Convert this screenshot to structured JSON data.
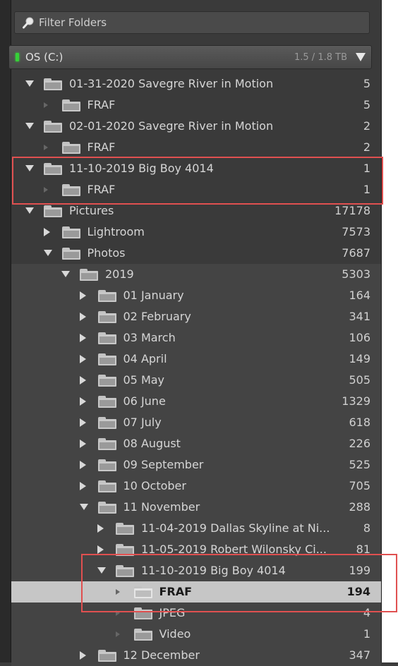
{
  "filter": {
    "label": "Filter Folders"
  },
  "volume": {
    "name": "OS (C:)",
    "size": "1.5 / 1.8 TB"
  },
  "tree": [
    {
      "name": "01-31-2020 Savegre River in Motion",
      "count": "5",
      "level": 0,
      "toggle": "open"
    },
    {
      "name": "FRAF",
      "count": "5",
      "level": 1,
      "toggle": "leaf"
    },
    {
      "name": "02-01-2020 Savegre River in Motion",
      "count": "2",
      "level": 0,
      "toggle": "open"
    },
    {
      "name": "FRAF",
      "count": "2",
      "level": 1,
      "toggle": "leaf"
    },
    {
      "name": "11-10-2019 Big Boy 4014",
      "count": "1",
      "level": 0,
      "toggle": "open"
    },
    {
      "name": "FRAF",
      "count": "1",
      "level": 1,
      "toggle": "leaf"
    },
    {
      "name": "Pictures",
      "count": "17178",
      "level": 0,
      "toggle": "open"
    },
    {
      "name": "Lightroom",
      "count": "7573",
      "level": 1,
      "toggle": "closed"
    },
    {
      "name": "Photos",
      "count": "7687",
      "level": 1,
      "toggle": "open"
    },
    {
      "name": "2019",
      "count": "5303",
      "level": 2,
      "toggle": "open"
    },
    {
      "name": "01 January",
      "count": "164",
      "level": 3,
      "toggle": "closed"
    },
    {
      "name": "02 February",
      "count": "341",
      "level": 3,
      "toggle": "closed"
    },
    {
      "name": "03 March",
      "count": "106",
      "level": 3,
      "toggle": "closed"
    },
    {
      "name": "04 April",
      "count": "149",
      "level": 3,
      "toggle": "closed"
    },
    {
      "name": "05 May",
      "count": "505",
      "level": 3,
      "toggle": "closed"
    },
    {
      "name": "06 June",
      "count": "1329",
      "level": 3,
      "toggle": "closed"
    },
    {
      "name": "07 July",
      "count": "618",
      "level": 3,
      "toggle": "closed"
    },
    {
      "name": "08 August",
      "count": "226",
      "level": 3,
      "toggle": "closed"
    },
    {
      "name": "09 September",
      "count": "525",
      "level": 3,
      "toggle": "closed"
    },
    {
      "name": "10 October",
      "count": "705",
      "level": 3,
      "toggle": "closed"
    },
    {
      "name": "11 November",
      "count": "288",
      "level": 3,
      "toggle": "open"
    },
    {
      "name": "11-04-2019 Dallas Skyline at Ni...",
      "count": "8",
      "level": 4,
      "toggle": "closed"
    },
    {
      "name": "11-05-2019 Robert Wilonsky Ci...",
      "count": "81",
      "level": 4,
      "toggle": "closed"
    },
    {
      "name": "11-10-2019 Big Boy 4014",
      "count": "199",
      "level": 4,
      "toggle": "open"
    },
    {
      "name": "FRAF",
      "count": "194",
      "level": 5,
      "toggle": "leaf",
      "selected": true
    },
    {
      "name": "JPEG",
      "count": "4",
      "level": 5,
      "toggle": "leaf"
    },
    {
      "name": "Video",
      "count": "1",
      "level": 5,
      "toggle": "leaf"
    },
    {
      "name": "12 December",
      "count": "347",
      "level": 3,
      "toggle": "closed"
    }
  ],
  "colors": {
    "highlight_box": "#e05050",
    "selected_row": "#c6c6c6",
    "panel": "#3a3a3a",
    "drive_led": "#36d038"
  }
}
